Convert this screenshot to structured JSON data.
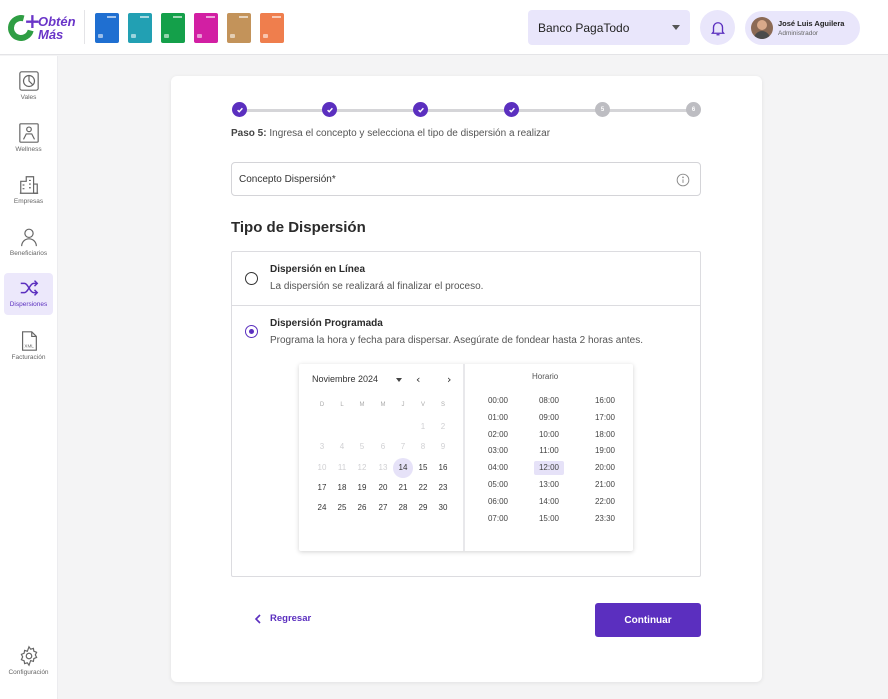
{
  "brand": {
    "logo_line1": "Obtén",
    "logo_line2": "Más",
    "card_colors": [
      "#1f6fd1",
      "#22a0b3",
      "#14a04a",
      "#d21fa3",
      "#c3935a",
      "#ef7e4d"
    ],
    "accent": "#5b2fbf"
  },
  "header": {
    "bank": "Banco PagaTodo",
    "user_name": "José Luis Aguilera",
    "user_role": "Administrador"
  },
  "sidebar": {
    "items": [
      {
        "label": "Vales",
        "icon": "chart-icon"
      },
      {
        "label": "Wellness",
        "icon": "wellness-icon"
      },
      {
        "label": "Empresas",
        "icon": "building-icon"
      },
      {
        "label": "Beneficiarios",
        "icon": "person-icon"
      },
      {
        "label": "Dispersiones",
        "icon": "shuffle-icon",
        "active": true
      },
      {
        "label": "Facturación",
        "icon": "xml-file-icon"
      }
    ],
    "settings_label": "Configuración"
  },
  "stepper": {
    "steps": [
      "1",
      "2",
      "3",
      "4",
      "5",
      "6"
    ],
    "completed": 4,
    "step_prefix": "Paso 5:",
    "step_text": "Ingresa el concepto y selecciona el tipo de dispersión a realizar"
  },
  "concept_field": {
    "label": "Concepto Dispersión*"
  },
  "dispersion": {
    "title": "Tipo de Dispersión",
    "options": [
      {
        "title": "Dispersión en Línea",
        "desc": "La dispersión se realizará al finalizar el proceso.",
        "selected": false
      },
      {
        "title": "Dispersión Programada",
        "desc": "Programa la hora y fecha para dispersar. Asegúrate de fondear hasta 2 horas antes.",
        "selected": true
      }
    ]
  },
  "calendar": {
    "month": "Noviembre 2024",
    "prev": "‹",
    "next": "›",
    "weekdays": [
      "D",
      "L",
      "M",
      "M",
      "J",
      "V",
      "S"
    ],
    "weeks": [
      [
        "",
        "",
        "",
        "",
        "",
        "1",
        "2"
      ],
      [
        "",
        "",
        "",
        "",
        "",
        "",
        ""
      ],
      [
        "",
        "",
        "",
        "",
        "",
        "",
        ""
      ],
      [
        "",
        "",
        "",
        "",
        "",
        "",
        ""
      ],
      [
        "",
        "",
        "",
        "",
        "",
        "",
        ""
      ],
      [
        "",
        "",
        "",
        "",
        "",
        "",
        ""
      ]
    ],
    "rows": [
      [
        "",
        "",
        "",
        "",
        "",
        "1",
        "2"
      ],
      [
        "3",
        "4",
        "5",
        "6",
        "7",
        "8",
        "9"
      ],
      [
        "10",
        "11",
        "12",
        "13",
        "14",
        "15",
        "16"
      ]
    ],
    "grid": [
      [
        {
          "d": "",
          "s": "d"
        },
        {
          "d": "",
          "s": "d"
        },
        {
          "d": "",
          "s": "d"
        },
        {
          "d": "",
          "s": "d"
        },
        {
          "d": "",
          "s": "d"
        },
        {
          "d": "1",
          "s": "d"
        },
        {
          "d": "2",
          "s": "d"
        }
      ],
      [
        {
          "d": "3",
          "s": "d"
        },
        {
          "d": "4",
          "s": "d"
        },
        {
          "d": "5",
          "s": "d"
        },
        {
          "d": "6",
          "s": "d"
        },
        {
          "d": "7",
          "s": "d"
        },
        {
          "d": "8",
          "s": "d"
        },
        {
          "d": "9",
          "s": "d"
        }
      ],
      [
        {
          "d": "10",
          "s": "d"
        },
        {
          "d": "11",
          "s": "d"
        },
        {
          "d": "12",
          "s": "d"
        },
        {
          "d": "13",
          "s": "d"
        },
        {
          "d": "14",
          "s": "d"
        },
        {
          "d": "15",
          "s": "d"
        },
        {
          "d": "16",
          "s": "d"
        }
      ]
    ],
    "days": [
      [
        "",
        "",
        "",
        "",
        "",
        "1",
        "2"
      ],
      [
        "3",
        "4",
        "5",
        "6",
        "7",
        "8",
        "9"
      ],
      [
        "10",
        "11",
        "12",
        "13",
        "14",
        "15",
        "16"
      ],
      [
        "17",
        "18",
        "19",
        "20",
        "21",
        "22",
        "23"
      ],
      [
        "24",
        "25",
        "26",
        "27",
        "28",
        "29",
        "30"
      ]
    ],
    "selected_day": "14",
    "horario_label": "Horario",
    "times": [
      [
        "00:00",
        "01:00",
        "02:00",
        "03:00",
        "04:00",
        "05:00",
        "06:00",
        "07:00"
      ],
      [
        "08:00",
        "09:00",
        "10:00",
        "11:00",
        "12:00",
        "13:00",
        "14:00",
        "15:00"
      ],
      [
        "16:00",
        "17:00",
        "18:00",
        "19:00",
        "20:00",
        "21:00",
        "22:00",
        "23:30"
      ]
    ],
    "selected_time": "12:00"
  },
  "footer": {
    "back": "Regresar",
    "continue": "Continuar"
  }
}
